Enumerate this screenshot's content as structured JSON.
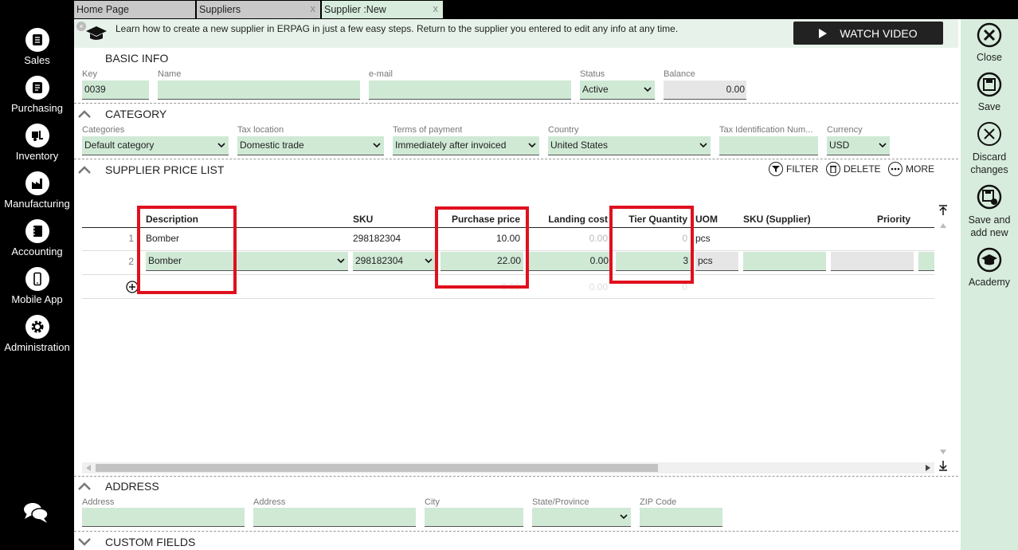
{
  "tabs": [
    {
      "label": "Home Page",
      "close": ""
    },
    {
      "label": "Suppliers",
      "close": "x"
    },
    {
      "label": "Supplier :New",
      "close": "x"
    }
  ],
  "nav": [
    {
      "label": "Sales",
      "icon": "sales-icon"
    },
    {
      "label": "Purchasing",
      "icon": "purchasing-icon"
    },
    {
      "label": "Inventory",
      "icon": "inventory-icon"
    },
    {
      "label": "Manufacturing",
      "icon": "manufacturing-icon"
    },
    {
      "label": "Accounting",
      "icon": "accounting-icon"
    },
    {
      "label": "Mobile App",
      "icon": "mobile-app-icon"
    },
    {
      "label": "Administration",
      "icon": "gear-icon"
    }
  ],
  "banner": {
    "text": "Learn how to create a new supplier in ERPAG in just a few easy steps. Return to the supplier you entered to edit any info at any time.",
    "watch_label": "WATCH VIDEO"
  },
  "actions": {
    "close": "Close",
    "save": "Save",
    "discard": "Discard changes",
    "save_new": "Save and add new",
    "academy": "Academy"
  },
  "basic_info": {
    "title": "BASIC INFO",
    "key_label": "Key",
    "key_value": "0039",
    "name_label": "Name",
    "name_value": "",
    "email_label": "e-mail",
    "email_value": "",
    "status_label": "Status",
    "status_value": "Active",
    "balance_label": "Balance",
    "balance_value": "0.00"
  },
  "category": {
    "title": "CATEGORY",
    "categories_label": "Categories",
    "categories_value": "Default category",
    "tax_location_label": "Tax location",
    "tax_location_value": "Domestic trade",
    "terms_label": "Terms of payment",
    "terms_value": "Immediately after invoiced",
    "country_label": "Country",
    "country_value": "United States",
    "tax_id_label": "Tax Identification Num...",
    "tax_id_value": "",
    "currency_label": "Currency",
    "currency_value": "USD"
  },
  "price_list": {
    "title": "SUPPLIER PRICE LIST",
    "filter": "FILTER",
    "delete": "DELETE",
    "more": "MORE",
    "columns": {
      "description": "Description",
      "sku": "SKU",
      "purchase_price": "Purchase price",
      "landing_cost": "Landing cost",
      "tier_quantity": "Tier Quantity",
      "uom": "UOM",
      "sku_supplier": "SKU (Supplier)",
      "priority": "Priority"
    },
    "rows": [
      {
        "num": "1",
        "description": "Bomber",
        "sku": "298182304",
        "purchase_price": "10.00",
        "landing_cost": "0.00",
        "tier_quantity": "0",
        "uom": "pcs"
      },
      {
        "num": "2",
        "description": "Bomber",
        "sku": "298182304",
        "purchase_price": "22.00",
        "landing_cost": "0.00",
        "tier_quantity": "3",
        "uom": "pcs"
      }
    ],
    "new_row": {
      "purchase_price": "0.00",
      "landing_cost": "0.00",
      "tier_quantity": "0"
    }
  },
  "address": {
    "title": "ADDRESS",
    "address1_label": "Address",
    "address2_label": "Address",
    "city_label": "City",
    "state_label": "State/Province",
    "zip_label": "ZIP Code"
  },
  "custom_fields": {
    "title": "CUSTOM FIELDS"
  },
  "colors": {
    "accent_green": "#cfe9d5",
    "panel_green": "#d7ecdc",
    "highlight_red": "#e0101e"
  }
}
